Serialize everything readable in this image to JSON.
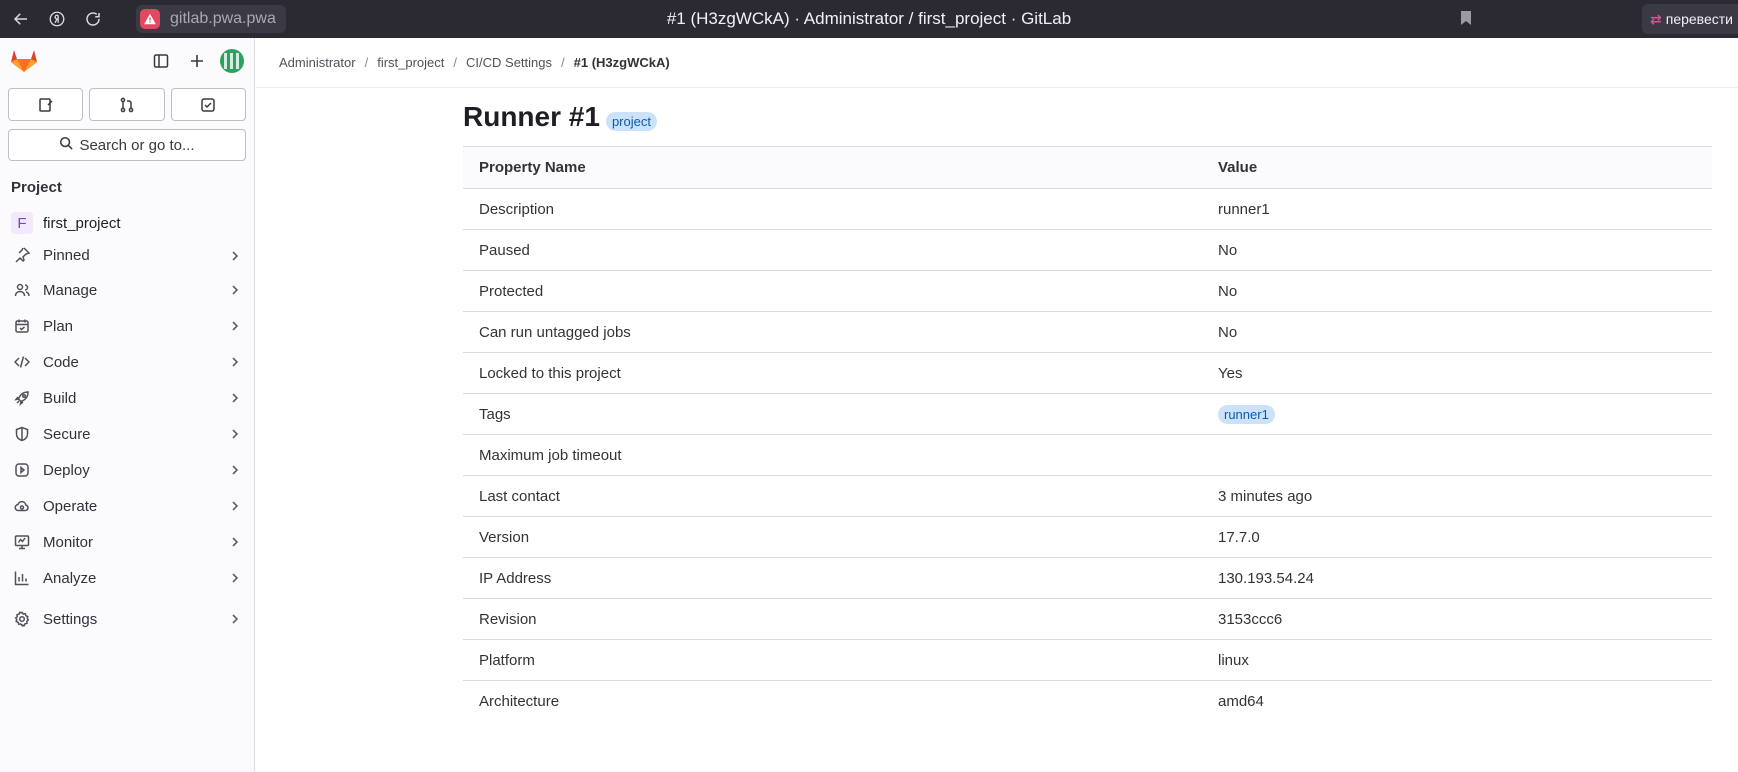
{
  "browser": {
    "url": "gitlab.pwa.pwa",
    "tab_title": "#1 (H3zgWCkA) · Administrator / first_project · GitLab",
    "translate_label": "перевести"
  },
  "sidebar": {
    "search_label": "Search or go to...",
    "section_title": "Project",
    "project": {
      "initial": "F",
      "name": "first_project"
    },
    "items": [
      {
        "label": "Pinned",
        "icon": "pin-icon"
      },
      {
        "label": "Manage",
        "icon": "users-icon"
      },
      {
        "label": "Plan",
        "icon": "calendar-icon"
      },
      {
        "label": "Code",
        "icon": "code-icon"
      },
      {
        "label": "Build",
        "icon": "rocket-icon"
      },
      {
        "label": "Secure",
        "icon": "shield-icon"
      },
      {
        "label": "Deploy",
        "icon": "deployments-icon"
      },
      {
        "label": "Operate",
        "icon": "cloud-icon"
      },
      {
        "label": "Monitor",
        "icon": "monitor-icon"
      },
      {
        "label": "Analyze",
        "icon": "chart-icon"
      },
      {
        "label": "Settings",
        "icon": "settings-icon"
      }
    ]
  },
  "breadcrumb": {
    "items": [
      "Administrator",
      "first_project",
      "CI/CD Settings"
    ],
    "current": "#1 (H3zgWCkA)"
  },
  "page": {
    "title": "Runner #1",
    "badge": "project"
  },
  "table": {
    "headers": [
      "Property Name",
      "Value"
    ],
    "rows": [
      {
        "name": "Description",
        "value": "runner1"
      },
      {
        "name": "Paused",
        "value": "No"
      },
      {
        "name": "Protected",
        "value": "No"
      },
      {
        "name": "Can run untagged jobs",
        "value": "No"
      },
      {
        "name": "Locked to this project",
        "value": "Yes"
      },
      {
        "name": "Tags",
        "tag": "runner1"
      },
      {
        "name": "Maximum job timeout",
        "value": ""
      },
      {
        "name": "Last contact",
        "value": "3 minutes ago"
      },
      {
        "name": "Version",
        "value": "17.7.0"
      },
      {
        "name": "IP Address",
        "value": "130.193.54.24"
      },
      {
        "name": "Revision",
        "value": "3153ccc6"
      },
      {
        "name": "Platform",
        "value": "linux"
      },
      {
        "name": "Architecture",
        "value": "amd64"
      }
    ]
  }
}
